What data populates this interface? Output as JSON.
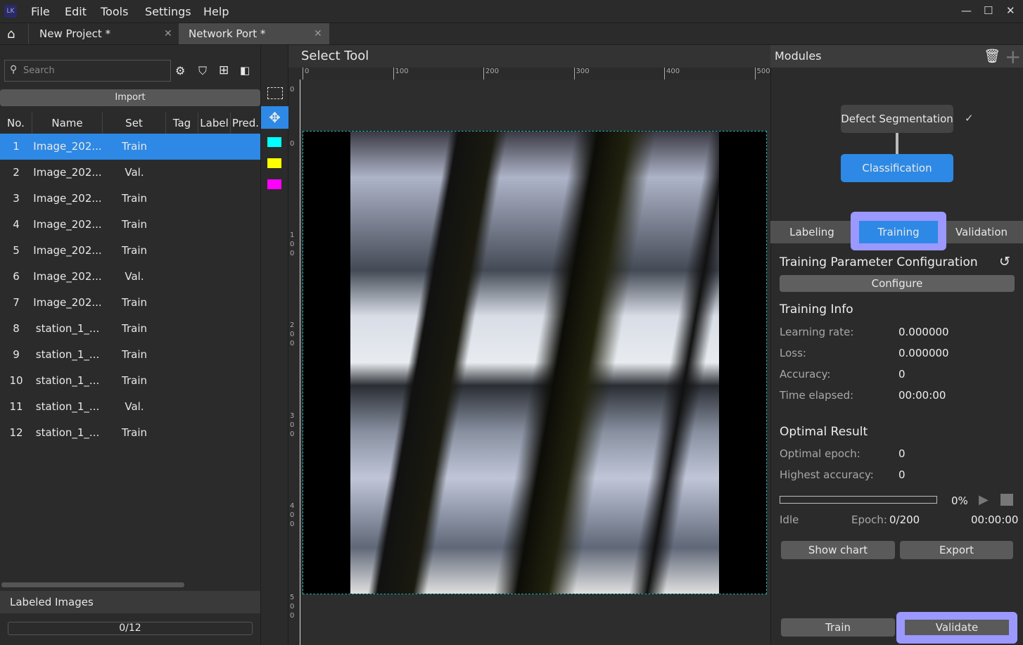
{
  "app": {
    "logo": "LK",
    "menu": [
      "File",
      "Edit",
      "Tools",
      "Settings",
      "Help"
    ]
  },
  "tabs": [
    {
      "label": "New Project *"
    },
    {
      "label": "Network Port *"
    }
  ],
  "sidebar": {
    "search_placeholder": "Search",
    "import_label": "Import",
    "columns": [
      "No.",
      "Name",
      "Set",
      "Tag",
      "Label",
      "Pred."
    ],
    "rows": [
      {
        "no": "1",
        "name": "Image_202...",
        "set": "Train"
      },
      {
        "no": "2",
        "name": "Image_202...",
        "set": "Val."
      },
      {
        "no": "3",
        "name": "Image_202...",
        "set": "Train"
      },
      {
        "no": "4",
        "name": "Image_202...",
        "set": "Train"
      },
      {
        "no": "5",
        "name": "Image_202...",
        "set": "Train"
      },
      {
        "no": "6",
        "name": "Image_202...",
        "set": "Val."
      },
      {
        "no": "7",
        "name": "Image_202...",
        "set": "Train"
      },
      {
        "no": "8",
        "name": "station_1_...",
        "set": "Train"
      },
      {
        "no": "9",
        "name": "station_1_...",
        "set": "Train"
      },
      {
        "no": "10",
        "name": "station_1_...",
        "set": "Train"
      },
      {
        "no": "11",
        "name": "station_1_...",
        "set": "Val."
      },
      {
        "no": "12",
        "name": "station_1_...",
        "set": "Train"
      }
    ],
    "selected_row": 1,
    "labeled_title": "Labeled Images",
    "labeled_progress": "0/12"
  },
  "tools": {
    "colors": [
      "#00ffff",
      "#ffff00",
      "#ff00ff"
    ]
  },
  "canvas": {
    "title": "Select Tool",
    "ruler_top": [
      "0",
      "100",
      "200",
      "300",
      "400",
      "500"
    ],
    "ruler_left": [
      "0",
      "0",
      "100",
      "200",
      "300",
      "400",
      "500"
    ]
  },
  "modules": {
    "title": "Modules",
    "nodes": [
      "Defect Segmentation",
      "Classification"
    ],
    "subtabs": [
      "Labeling",
      "Training",
      "Validation"
    ],
    "param_title": "Training Parameter Configuration",
    "configure": "Configure",
    "info_title": "Training Info",
    "info": [
      {
        "k": "Learning rate:",
        "v": "0.000000"
      },
      {
        "k": "Loss:",
        "v": "0.000000"
      },
      {
        "k": "Accuracy:",
        "v": "0"
      },
      {
        "k": "Time elapsed:",
        "v": "00:00:00"
      }
    ],
    "optimal_title": "Optimal Result",
    "optimal": [
      {
        "k": "Optimal epoch:",
        "v": "0"
      },
      {
        "k": "Highest accuracy:",
        "v": "0"
      }
    ],
    "progress_percent": "0%",
    "progress_value": 0,
    "status": "Idle",
    "epoch_label": "Epoch:",
    "epoch_value": "0/200",
    "time": "00:00:00",
    "show_chart": "Show chart",
    "export": "Export",
    "train": "Train",
    "validate": "Validate",
    "accent": "#2d89e5",
    "highlight": "#9b98ff"
  }
}
